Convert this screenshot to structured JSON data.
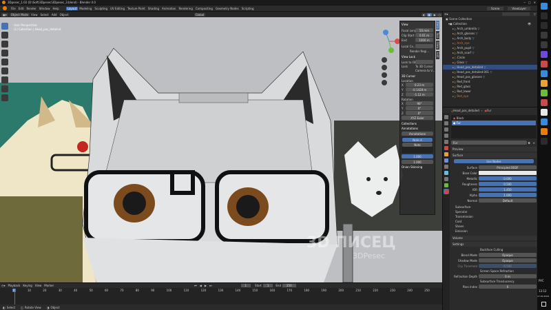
{
  "window": {
    "title": "3Dpesec_1.02 (D:\\Soft\\3Dpesec\\3Dpesec_3.blend) - Blender 4.0"
  },
  "menu": {
    "items": [
      "File",
      "Edit",
      "Render",
      "Window",
      "Help"
    ]
  },
  "workspaces": {
    "tabs": [
      "Layout",
      "Modeling",
      "Sculpting",
      "UV Editing",
      "Texture Paint",
      "Shading",
      "Animation",
      "Rendering",
      "Compositing",
      "Geometry Nodes",
      "Scripting"
    ]
  },
  "viewport": {
    "mode": "Object Mode",
    "view_menus": [
      "View",
      "Select",
      "Add",
      "Object"
    ],
    "orientation": "Global",
    "overlay_title": "User Perspective",
    "overlay_subtitle": "(1) Collection | Head_pos_detailed",
    "watermark_main": "3D ПИСЕЦ",
    "watermark_sub": "3DPesec"
  },
  "npanel": {
    "view_header": "View",
    "focal_length_label": "Focal Length",
    "focal_length": "50 mm",
    "clip_start_label": "Clip Start",
    "clip_start": "0.01 m",
    "clip_end_label": "End",
    "clip_end": "1000 m",
    "local_camera_label": "Local Ca...",
    "render_region_label": "Render Regi...",
    "view_lock_header": "View Lock",
    "lock_to_object_label": "Lock to Ob...",
    "lock_label": "Lock",
    "to_3d_cursor": "To 3D Cursor",
    "camera_to_view": "Camera to V...",
    "cursor_header": "3D Cursor",
    "location_label": "Location",
    "loc_x": "0.23 m",
    "loc_y": "-0.1428 m",
    "loc_z": "-1.12 m",
    "rotation_label": "Rotation",
    "rot_x": "90°",
    "rot_y": "0°",
    "rot_z": "0°",
    "rotation_mode": "XYZ Euler",
    "collections_header": "Collections",
    "annotations_header": "Annotations",
    "annotations_value": "Annotations",
    "note_a": "Note A",
    "note_b": "Note",
    "onion_header": "Onion Skinning",
    "layer_value_a": "1.000",
    "layer_value_b": "1.000"
  },
  "tabs_vertical": [
    "Item",
    "Tool",
    "View",
    "Edit"
  ],
  "timeline": {
    "menus": [
      "Playback",
      "Keying",
      "View",
      "Marker"
    ],
    "ticks": [
      "0",
      "10",
      "20",
      "30",
      "40",
      "50",
      "60",
      "70",
      "80",
      "90",
      "100",
      "110",
      "120",
      "130",
      "140",
      "150",
      "160",
      "170",
      "180",
      "190",
      "200",
      "210",
      "220",
      "230",
      "240",
      "250"
    ],
    "current_frame": "1",
    "start_label": "Start",
    "start": "1",
    "end_label": "End",
    "end": "250"
  },
  "statusbar": {
    "select": "Select",
    "rotate": "Rotate View",
    "object": "Object"
  },
  "outliner": {
    "header": "Scene Collection",
    "items": [
      "Collection",
      "Arch_umbrella",
      "Arch_glasses",
      "Arch_body",
      "Arch_eye",
      "Arch_pupil",
      "Arch_scarf",
      "Circle",
      "Glass",
      "Head_pos_detailed",
      "Head_pos_detailed.001",
      "Head_pos_glasses",
      "Red_front",
      "Red_glass",
      "Red_lower",
      "Red_eye"
    ],
    "view_layer": "ViewLayer",
    "scene": "Scene"
  },
  "properties": {
    "object_name": "Head_pos_detailed",
    "material_tab": "Fur",
    "slots": [
      "Black",
      "Fur"
    ],
    "material_name": "Fur",
    "preview_header": "Preview",
    "surface_header": "Surface",
    "use_nodes": "Use Nodes",
    "surface_label": "Surface",
    "surface_value": "Principled BSDF",
    "base_color_label": "Base Color",
    "metallic_label": "Metallic",
    "metallic": "0.000",
    "roughness_label": "Roughness",
    "roughness": "0.500",
    "ior_label": "IOR",
    "ior": "1.450",
    "alpha_label": "Alpha",
    "alpha": "1.000",
    "normal_label": "Normal",
    "normal": "Default",
    "subsections": [
      "Subsurface",
      "Specular",
      "Transmission",
      "Coat",
      "Sheen",
      "Emission"
    ],
    "volume_header": "Volume",
    "settings_header": "Settings",
    "backface": "Backface Culling",
    "blend_mode_label": "Blend Mode",
    "blend_mode": "Opaque",
    "shadow_mode_label": "Shadow Mode",
    "shadow_mode": "Opaque",
    "clip_threshold_label": "Clip Threshold",
    "clip_threshold": "0.500",
    "screen_refraction": "Screen Space Refraction",
    "refraction_depth_label": "Refraction Depth",
    "refraction_depth": "0 m",
    "subsurface_translucency": "Subsurface Translucency",
    "pass_index_label": "Pass Index",
    "pass_index": "0"
  },
  "tray": {
    "lang": "РУС",
    "time": "13:12",
    "date": "17.02.2024"
  },
  "colors": {
    "accent": "#4772b3",
    "panel": "#303030",
    "header": "#2b2b2b",
    "teal": "#2c7a6c"
  }
}
